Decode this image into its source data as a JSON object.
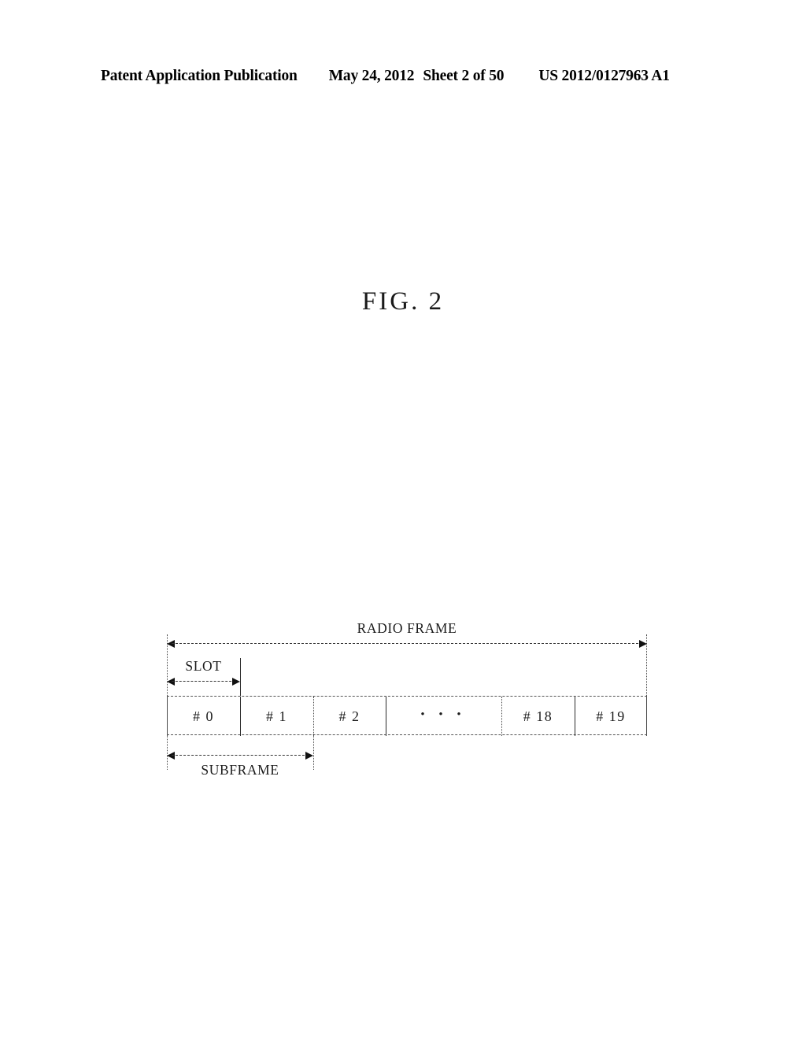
{
  "header": {
    "publication": "Patent Application Publication",
    "date": "May 24, 2012",
    "sheet": "Sheet 2 of 50",
    "patent_number": "US 2012/0127963 A1"
  },
  "figure": {
    "title": "FIG. 2"
  },
  "diagram": {
    "labels": {
      "radio_frame": "RADIO FRAME",
      "slot": "SLOT",
      "subframe": "SUBFRAME"
    },
    "cells": [
      {
        "label": "# 0"
      },
      {
        "label": "# 1"
      },
      {
        "label": "# 2"
      },
      {
        "label": "• • •"
      },
      {
        "label": "# 18"
      },
      {
        "label": "# 19"
      }
    ]
  },
  "colors": {
    "ink": "#000000",
    "line": "#4a4a4a",
    "paper": "#ffffff"
  }
}
